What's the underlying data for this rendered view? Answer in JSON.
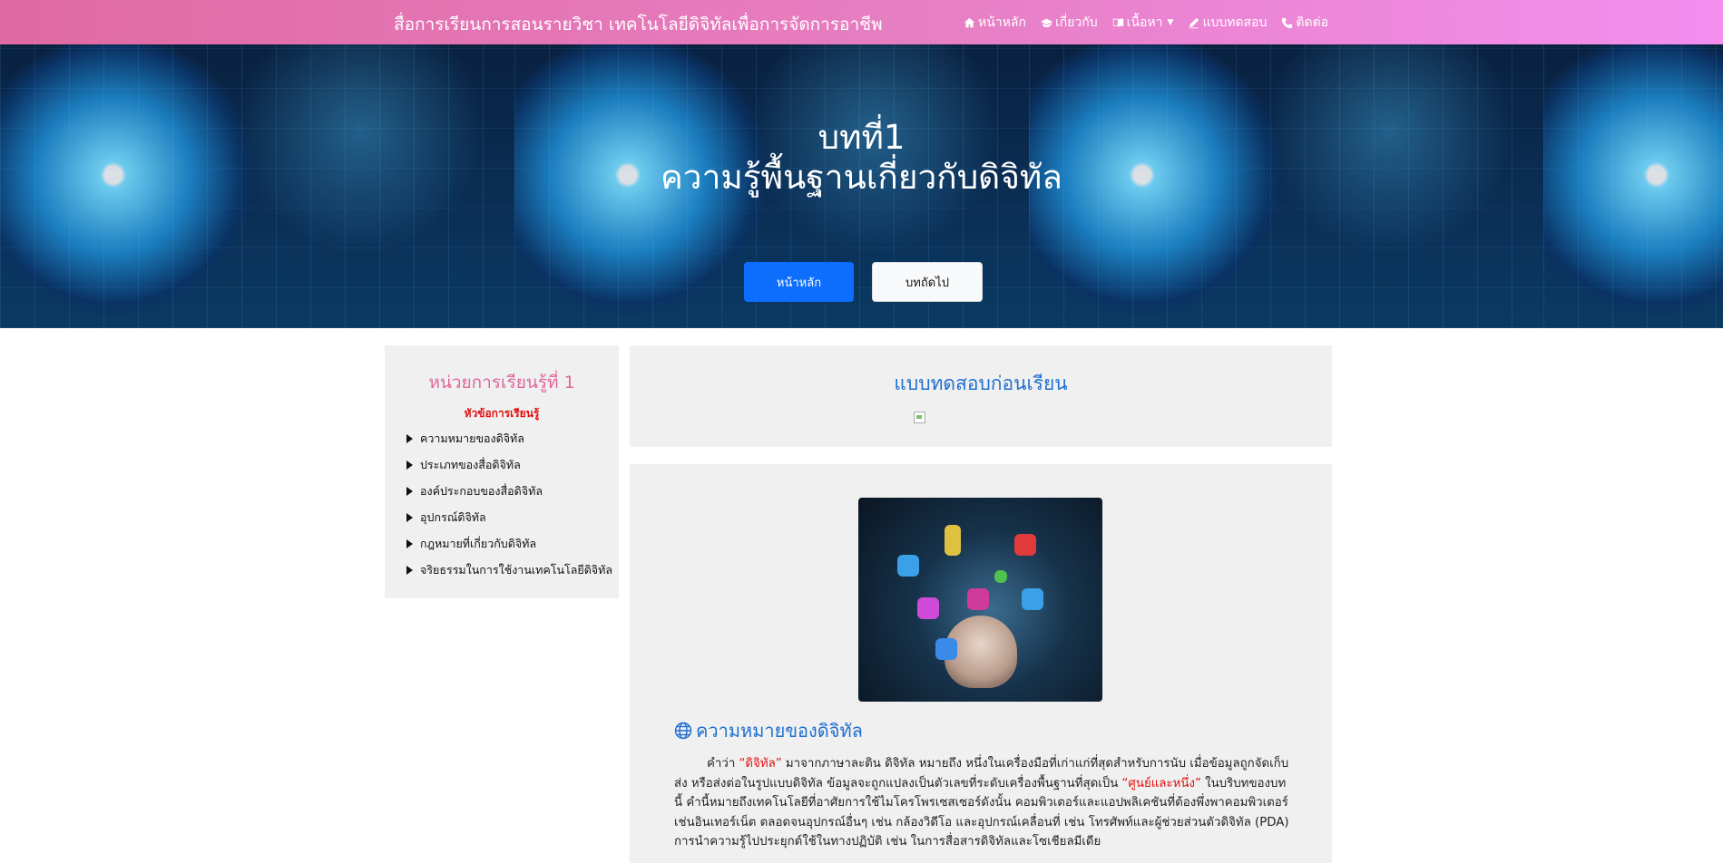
{
  "navbar": {
    "brand": "สื่อการเรียนการสอนรายวิชา เทคโนโลยีดิจิทัลเพื่อการจัดการอาชีพ",
    "items": [
      {
        "label": "หน้าหลัก",
        "icon": "home-icon"
      },
      {
        "label": "เกี่ยวกับ",
        "icon": "graduation-cap-icon"
      },
      {
        "label": "เนื้อหา",
        "icon": "book-icon",
        "dropdown": true
      },
      {
        "label": "แบบทดสอบ",
        "icon": "pencil-icon"
      },
      {
        "label": "ติดต่อ",
        "icon": "phone-icon"
      }
    ]
  },
  "hero": {
    "title_line1": "บทที่1",
    "title_line2": "ความรู้พื้นฐานเกี่ยวกับดิจิทัล",
    "primary_button": "หน้าหลัก",
    "secondary_button": "บทถัดไป"
  },
  "sidebar": {
    "title": "หน่วยการเรียนรู้ที่ 1",
    "subtitle": "หัวข้อการเรียนรู้",
    "items": [
      "ความหมายของดิจิทัล",
      "ประเภทของสื่อดิจิทัล",
      "องค์ประกอบของสื่อดิจิทัล",
      "อุปกรณ์ดิจิทัล",
      "กฎหมายที่เกี่ยวกับดิจิทัล",
      "จริยธรรมในการใช้งานเทคโนโลยีดิจิทัล"
    ]
  },
  "pretest": {
    "title": "แบบทดสอบก่อนเรียน"
  },
  "content": {
    "section_title": "ความหมายของดิจิทัล",
    "para": {
      "p1": "คำว่า ",
      "r1": "“ดิจิทัล”",
      "p2": " มาจากภาษาละติน ดิจิทัล หมายถึง หนึ่งในเครื่องมือที่เก่าแก่ที่สุดสำหรับการนับ เมื่อข้อมูลถูกจัดเก็บ ส่ง หรือส่งต่อในรูปแบบดิจิทัล ข้อมูลจะถูกแปลงเป็นตัวเลขที่ระดับเครื่องพื้นฐานที่สุดเป็น ",
      "r2": "“ศูนย์และหนึ่ง”",
      "p3": " ในบริบทของบทนี้ คำนี้หมายถึงเทคโนโลยีที่อาศัยการใช้ไมโครโพรเซสเซอร์ดังนั้น คอมพิวเตอร์และแอปพลิเคชันที่ต้องพึ่งพาคอมพิวเตอร์ เช่นอินเทอร์เน็ต ตลอดจนอุปกรณ์อื่นๆ เช่น กล้องวิดีโอ และอุปกรณ์เคลื่อนที่ เช่น โทรศัพท์และผู้ช่วยส่วนตัวดิจิทัล (PDA) การนำความรู้ไปประยุกต์ใช้ในทางปฏิบัติ เช่น ในการสื่อสารดิจิทัลและโซเชียลมีเดีย"
    }
  },
  "colors": {
    "navbar_gradient_start": "#e06aa3",
    "navbar_gradient_end": "#f48ff0",
    "primary": "#0d6efd",
    "heading_blue": "#1f6fd1",
    "sidebar_title": "#e0669a",
    "accent_red": "#e01010"
  }
}
